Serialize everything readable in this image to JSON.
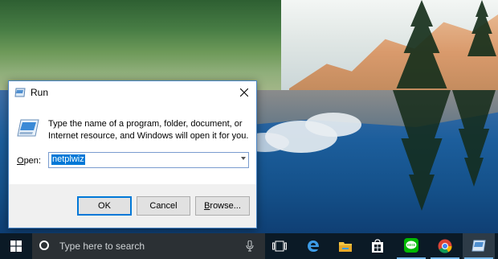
{
  "run_dialog": {
    "title": "Run",
    "close_symbol": "×",
    "description": "Type the name of a program, folder, document, or Internet resource, and Windows will open it for you.",
    "open_label_accel": "O",
    "open_label_rest": "pen:",
    "open_value": "netplwiz",
    "buttons": {
      "ok": "OK",
      "cancel": "Cancel",
      "browse_accel": "B",
      "browse_rest": "rowse..."
    }
  },
  "taskbar": {
    "search_placeholder": "Type here to search",
    "icons": [
      "windows-start-icon",
      "cortana-icon",
      "microphone-icon",
      "task-view-icon",
      "edge-icon",
      "file-explorer-icon",
      "store-icon",
      "line-app-icon",
      "chrome-icon",
      "run-app-icon"
    ],
    "active_app": "run-app-icon"
  },
  "colors": {
    "accent": "#0078d7",
    "taskbar": "#0b1a26",
    "search_box": "#2b3034",
    "line_green": "#00b900"
  }
}
